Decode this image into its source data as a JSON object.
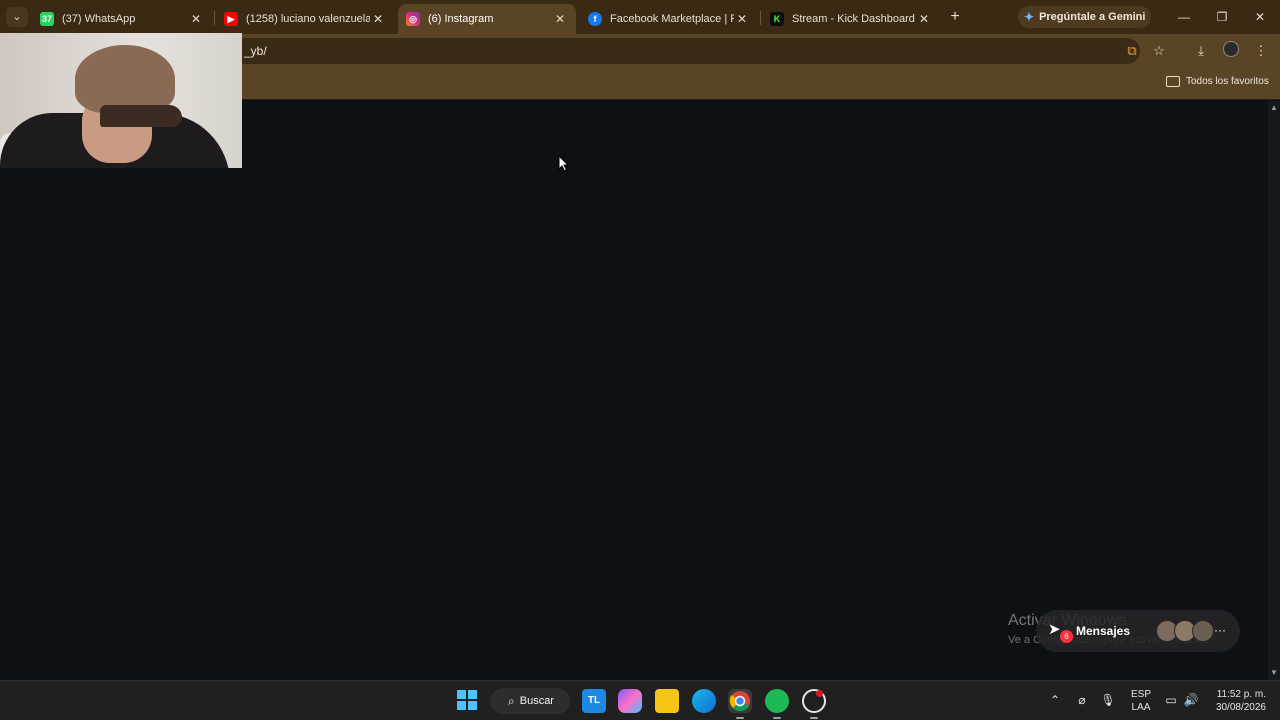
{
  "browser": {
    "tab_menu_icon": "chevron-down-icon",
    "tabs": [
      {
        "title": "(37) WhatsApp",
        "badge": "37",
        "favicon_color": "#25d366",
        "close": "✕"
      },
      {
        "title": "(1258) luciano valenzuela m",
        "favicon_color": "#ff0000",
        "close": "✕"
      },
      {
        "title": "(6) Instagram",
        "favicon_color": "#e1306c",
        "close": "✕"
      },
      {
        "title": "Facebook Marketplace | Fac",
        "favicon_color": "#1877f2",
        "close": "✕"
      },
      {
        "title": "Stream - Kick Dashboard",
        "favicon_color": "#53fc18",
        "close": "✕"
      }
    ],
    "new_tab": "+",
    "gemini_label": "Pregúntale a Gemini",
    "address_text": "_yb/",
    "bookmarks_folder_label": "Todos los favoritos"
  },
  "overlay": {
    "watermark_title": "Activar Windows",
    "watermark_subtitle": "Ve a Configuración para activar Windows.",
    "messages_label": "Mensajes",
    "messages_badge": "6",
    "messages_more": "···"
  },
  "taskbar": {
    "search_label": "Buscar",
    "lang_line1": "ESP",
    "lang_line2": "LAA",
    "time": "11:52 p. m.",
    "date": "30/08/2026"
  },
  "colors": {
    "tab_strip": "#3a2a14",
    "toolbar": "#5a4426",
    "page_bg": "#0e1114",
    "taskbar": "#202020"
  }
}
